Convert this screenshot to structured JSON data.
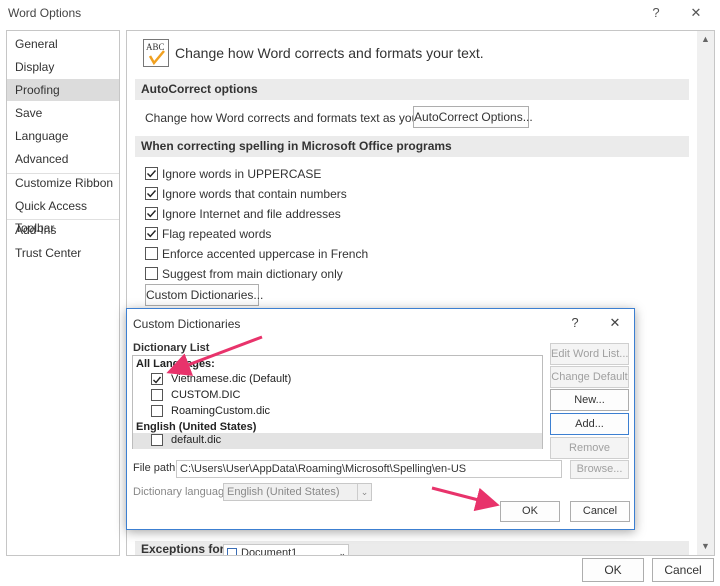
{
  "window": {
    "title": "Word Options",
    "help_label": "?",
    "close_label": "✕"
  },
  "sidebar": {
    "items": [
      {
        "label": "General"
      },
      {
        "label": "Display"
      },
      {
        "label": "Proofing"
      },
      {
        "label": "Save"
      },
      {
        "label": "Language"
      },
      {
        "label": "Advanced"
      },
      {
        "label": "Customize Ribbon"
      },
      {
        "label": "Quick Access Toolbar"
      },
      {
        "label": "Add-Ins"
      },
      {
        "label": "Trust Center"
      }
    ],
    "active": "Proofing"
  },
  "main": {
    "header": "Change how Word corrects and formats your text.",
    "header_icon_text": "ABC",
    "autocorrect_section": "AutoCorrect options",
    "autocorrect_label": "Change how Word corrects and formats text as you type:",
    "autocorrect_button": "AutoCorrect Options...",
    "spelling_section": "When correcting spelling in Microsoft Office programs",
    "checkboxes": [
      {
        "label": "Ignore words in UPPERCASE",
        "checked": true
      },
      {
        "label": "Ignore words that contain numbers",
        "checked": true
      },
      {
        "label": "Ignore Internet and file addresses",
        "checked": true
      },
      {
        "label": "Flag repeated words",
        "checked": true
      },
      {
        "label": "Enforce accented uppercase in French",
        "checked": false
      },
      {
        "label": "Suggest from main dictionary only",
        "checked": false
      }
    ],
    "custom_dict_button": "Custom Dictionaries...",
    "exceptions_label": "Exceptions for:",
    "exceptions_value": "Document1"
  },
  "dialog": {
    "title": "Custom Dictionaries",
    "help_label": "?",
    "close_label": "✕",
    "list_label": "Dictionary List",
    "groups": [
      {
        "name": "All Languages:",
        "items": [
          {
            "label": "Vietnamese.dic (Default)",
            "checked": true
          },
          {
            "label": "CUSTOM.DIC",
            "checked": false
          },
          {
            "label": "RoamingCustom.dic",
            "checked": false
          }
        ]
      },
      {
        "name": "English (United States)",
        "items": [
          {
            "label": "default.dic",
            "checked": false
          }
        ]
      }
    ],
    "buttons": {
      "edit": "Edit Word List...",
      "change_default": "Change Default",
      "new": "New...",
      "add": "Add...",
      "remove": "Remove",
      "browse": "Browse...",
      "ok": "OK",
      "cancel": "Cancel"
    },
    "file_path_label": "File path:",
    "file_path_value": "C:\\Users\\User\\AppData\\Roaming\\Microsoft\\Spelling\\en-US",
    "language_label": "Dictionary language:",
    "language_value": "English (United States)"
  },
  "footer": {
    "ok": "OK",
    "cancel": "Cancel"
  },
  "colors": {
    "annotation_arrow": "#e8336b",
    "focus_border": "#3c7fd1"
  }
}
